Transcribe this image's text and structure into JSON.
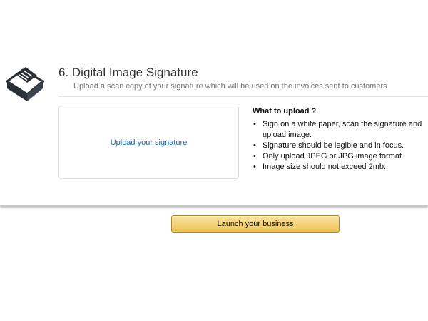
{
  "section": {
    "title": "6. Digital Image Signature",
    "subtitle": "Upload a scan copy of your signature which will be used on the invoices sent to customers",
    "icon": "signature-scanner-icon"
  },
  "upload": {
    "link_label": "Upload your signature"
  },
  "info": {
    "title": "What to upload ?",
    "items": [
      "Sign on a white paper, scan the signature and upload image.",
      "Signature should be legible and in focus.",
      "Only upload JPEG or JPG image format",
      "Image size should not exceed 2mb."
    ]
  },
  "launch_button": {
    "label": "Launch your business"
  },
  "colors": {
    "link": "#1a66b5",
    "button_top": "#f7e4a8",
    "button_bottom": "#f0c24f",
    "button_border": "#a88734",
    "icon_dark": "#2b2f36"
  }
}
